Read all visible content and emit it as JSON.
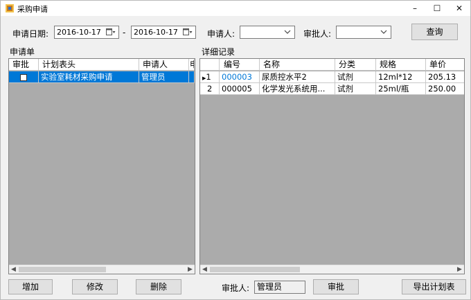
{
  "window": {
    "title": "采购申请"
  },
  "filters": {
    "date_label": "申请日期:",
    "date_from": "2016-10-17",
    "date_sep": "-",
    "date_to": "2016-10-17",
    "applicant_label": "申请人:",
    "applicant_value": "",
    "approver_label": "审批人:",
    "approver_value": "",
    "query_button": "查询"
  },
  "left_panel": {
    "title": "申请单",
    "columns": [
      "审批",
      "计划表头",
      "申请人",
      "申"
    ],
    "rows": [
      {
        "approve": "",
        "plan_header": "实验室耗材采购申请",
        "applicant": "管理员"
      }
    ]
  },
  "right_panel": {
    "title": "详细记录",
    "columns": [
      "",
      "编号",
      "名称",
      "分类",
      "规格",
      "单价"
    ],
    "rows": [
      {
        "row_no": "1",
        "id": "000003",
        "name": "尿质控水平2",
        "category": "试剂",
        "spec": "12ml*12",
        "price": "205.13"
      },
      {
        "row_no": "2",
        "id": "000005",
        "name": "化学发光系统用...",
        "category": "试剂",
        "spec": "25ml/瓶",
        "price": "250.00"
      }
    ]
  },
  "footer": {
    "add_button": "增加",
    "edit_button": "修改",
    "delete_button": "删除",
    "approver_label": "审批人:",
    "approver_value": "管理员",
    "approve_button": "审批",
    "export_button": "导出计划表"
  },
  "colors": {
    "selection": "#0078d7",
    "grid_bg": "#ababab",
    "window_bg": "#f0f0f0"
  }
}
